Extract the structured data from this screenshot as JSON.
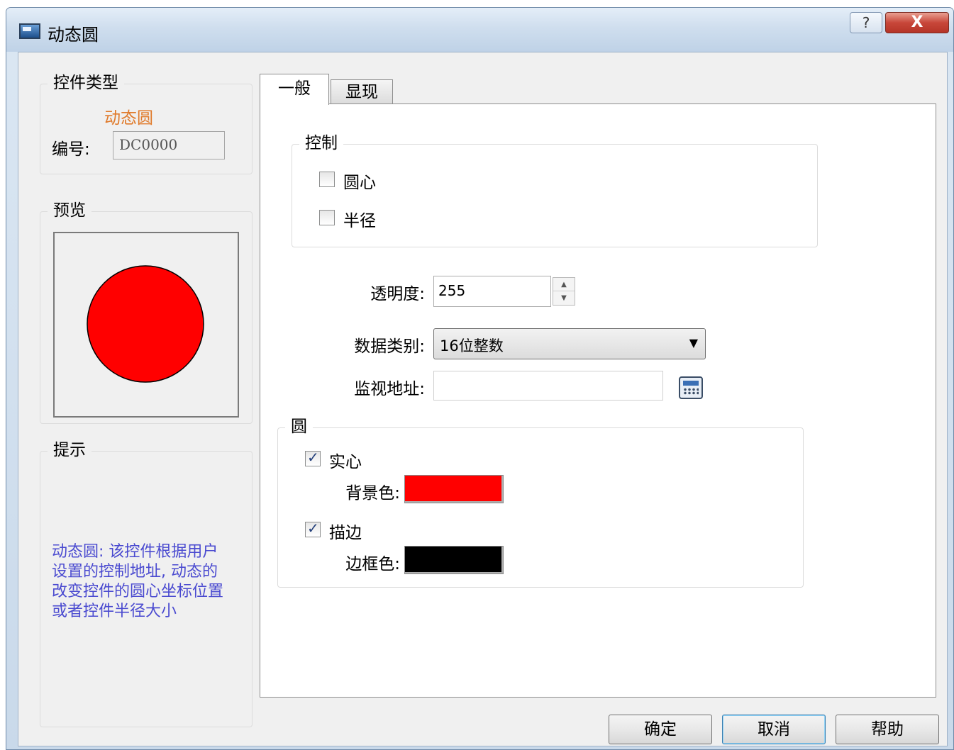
{
  "window": {
    "title": "动态圆",
    "help_label": "?",
    "close_label": "X"
  },
  "control_type": {
    "group_title": "控件类型",
    "type_name": "动态圆",
    "id_label": "编号:",
    "id_value": "DC0000"
  },
  "preview": {
    "group_title": "预览",
    "fill_color": "#ff0000",
    "stroke_color": "#000000"
  },
  "tip": {
    "group_title": "提示",
    "text": "动态圆: 该控件根据用户设置的控制地址, 动态的改变控件的圆心坐标位置或者控件半径大小"
  },
  "tabs": [
    {
      "label": "一般",
      "active": true
    },
    {
      "label": "显现",
      "active": false
    }
  ],
  "general": {
    "control_group": {
      "title": "控制",
      "options": [
        {
          "label": "圆心",
          "checked": false
        },
        {
          "label": "半径",
          "checked": false
        }
      ]
    },
    "opacity": {
      "label": "透明度:",
      "value": "255"
    },
    "data_type": {
      "label": "数据类别:",
      "value": "16位整数"
    },
    "monitor_address": {
      "label": "监视地址:",
      "value": ""
    },
    "circle_group": {
      "title": "圆",
      "solid": {
        "label": "实心",
        "checked": true
      },
      "background_label": "背景色:",
      "background_color": "#ff0000",
      "stroke": {
        "label": "描边",
        "checked": true
      },
      "border_label": "边框色:",
      "border_color": "#000000"
    }
  },
  "buttons": {
    "ok": "确定",
    "cancel": "取消",
    "help": "帮助"
  }
}
